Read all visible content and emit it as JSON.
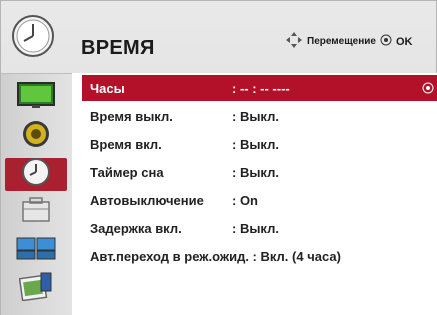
{
  "header": {
    "title": "ВРЕМЯ",
    "hint_move": "Перемещение",
    "hint_ok": "OK"
  },
  "sidebar": {
    "items": [
      {
        "icon": "picture-icon",
        "active": false
      },
      {
        "icon": "audio-speaker-icon",
        "active": false
      },
      {
        "icon": "clock-icon",
        "active": true
      },
      {
        "icon": "option-toolbox-icon",
        "active": false
      },
      {
        "icon": "input-screens-icon",
        "active": false
      },
      {
        "icon": "photo-usb-icon",
        "active": false
      }
    ]
  },
  "menu": {
    "rows": [
      {
        "label": "Часы",
        "value": ": -- : -- ----",
        "selected": true
      },
      {
        "label": "Время выкл.",
        "value": ": Выкл."
      },
      {
        "label": "Время вкл.",
        "value": ": Выкл."
      },
      {
        "label": "Таймер сна",
        "value": ": Выкл."
      },
      {
        "label": "Автовыключение",
        "value": ": On"
      },
      {
        "label": "Задержка вкл.",
        "value": ": Выкл."
      },
      {
        "label": "Авт.переход в реж.ожид. : Вкл. (4 часа)",
        "value": ""
      }
    ]
  },
  "colors": {
    "accent": "#b3112a",
    "sidebar_active": "#a9202f"
  }
}
